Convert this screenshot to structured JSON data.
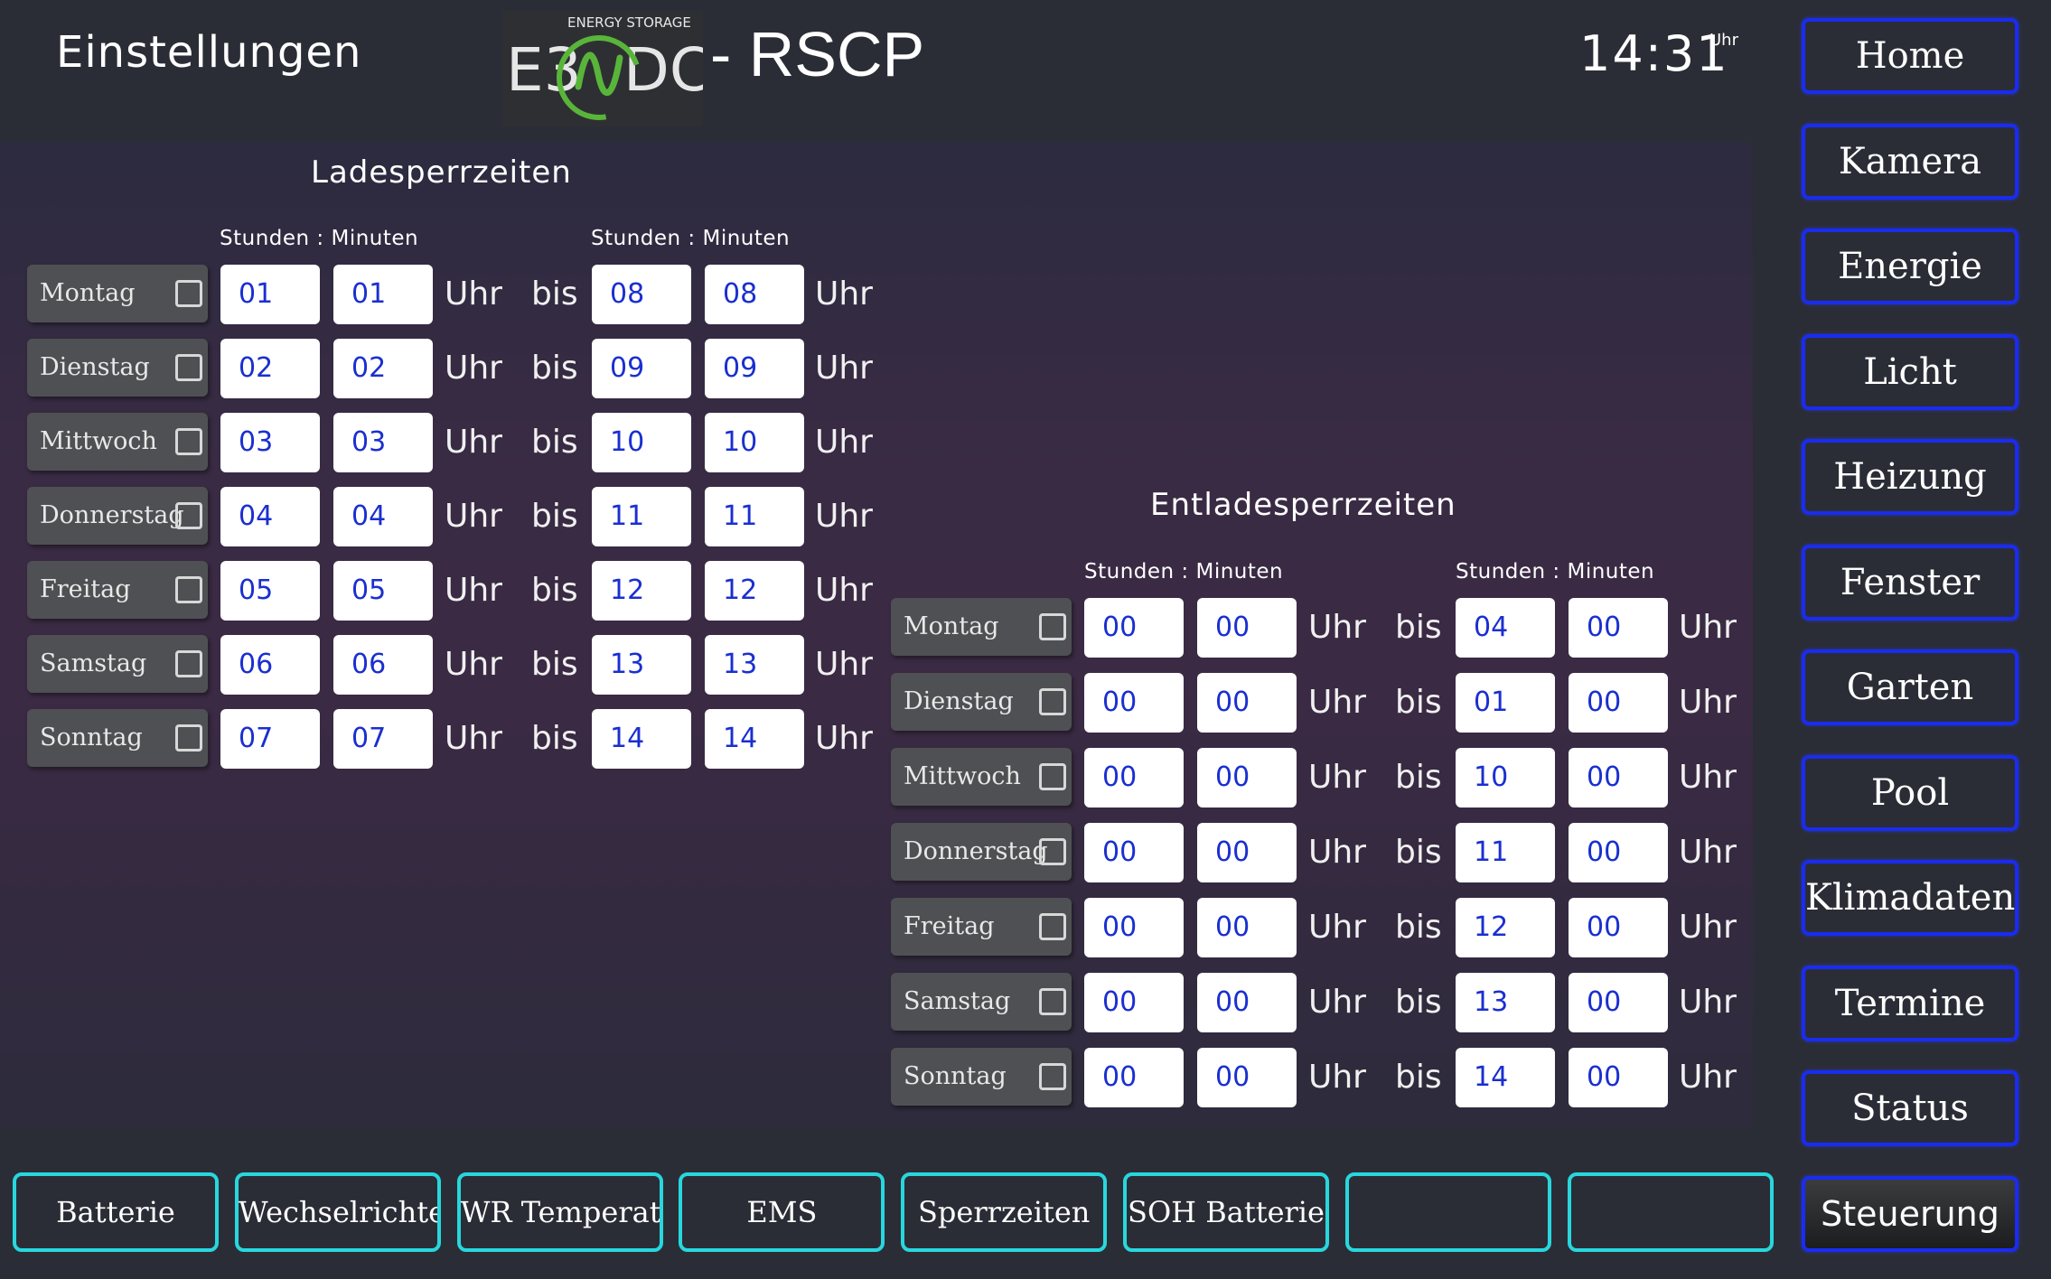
{
  "header": {
    "page_title": "Einstellungen",
    "logo_top_text": "ENERGY STORAGE",
    "logo_text_left": "E3",
    "logo_text_right": "DC",
    "app_title": "- RSCP",
    "clock": "14:31",
    "clock_unit": "Uhr"
  },
  "colors": {
    "nav_border": "#1a2cf0",
    "bottom_border": "#28d7de",
    "field_text": "#1a2fd0",
    "logo_green": "#58b53a"
  },
  "lade": {
    "title": "Ladesperrzeiten",
    "col_head_from": "Stunden : Minuten",
    "col_head_to": "Stunden : Minuten",
    "unit": "Uhr",
    "sep": "bis",
    "rows": [
      {
        "day": "Montag",
        "checked": false,
        "from_h": "01",
        "from_m": "01",
        "to_h": "08",
        "to_m": "08"
      },
      {
        "day": "Dienstag",
        "checked": false,
        "from_h": "02",
        "from_m": "02",
        "to_h": "09",
        "to_m": "09"
      },
      {
        "day": "Mittwoch",
        "checked": false,
        "from_h": "03",
        "from_m": "03",
        "to_h": "10",
        "to_m": "10"
      },
      {
        "day": "Donnerstag",
        "checked": false,
        "from_h": "04",
        "from_m": "04",
        "to_h": "11",
        "to_m": "11"
      },
      {
        "day": "Freitag",
        "checked": false,
        "from_h": "05",
        "from_m": "05",
        "to_h": "12",
        "to_m": "12"
      },
      {
        "day": "Samstag",
        "checked": false,
        "from_h": "06",
        "from_m": "06",
        "to_h": "13",
        "to_m": "13"
      },
      {
        "day": "Sonntag",
        "checked": false,
        "from_h": "07",
        "from_m": "07",
        "to_h": "14",
        "to_m": "14"
      }
    ]
  },
  "entlade": {
    "title": "Entladesperrzeiten",
    "col_head_from": "Stunden : Minuten",
    "col_head_to": "Stunden : Minuten",
    "unit": "Uhr",
    "sep": "bis",
    "rows": [
      {
        "day": "Montag",
        "checked": false,
        "from_h": "00",
        "from_m": "00",
        "to_h": "04",
        "to_m": "00"
      },
      {
        "day": "Dienstag",
        "checked": false,
        "from_h": "00",
        "from_m": "00",
        "to_h": "01",
        "to_m": "00"
      },
      {
        "day": "Mittwoch",
        "checked": false,
        "from_h": "00",
        "from_m": "00",
        "to_h": "10",
        "to_m": "00"
      },
      {
        "day": "Donnerstag",
        "checked": false,
        "from_h": "00",
        "from_m": "00",
        "to_h": "11",
        "to_m": "00"
      },
      {
        "day": "Freitag",
        "checked": false,
        "from_h": "00",
        "from_m": "00",
        "to_h": "12",
        "to_m": "00"
      },
      {
        "day": "Samstag",
        "checked": false,
        "from_h": "00",
        "from_m": "00",
        "to_h": "13",
        "to_m": "00"
      },
      {
        "day": "Sonntag",
        "checked": false,
        "from_h": "00",
        "from_m": "00",
        "to_h": "14",
        "to_m": "00"
      }
    ]
  },
  "nav": [
    {
      "label": "Home"
    },
    {
      "label": "Kamera"
    },
    {
      "label": "Energie"
    },
    {
      "label": "Licht"
    },
    {
      "label": "Heizung"
    },
    {
      "label": "Fenster"
    },
    {
      "label": "Garten"
    },
    {
      "label": "Pool"
    },
    {
      "label": "Klimadaten"
    },
    {
      "label": "Termine"
    },
    {
      "label": "Status"
    },
    {
      "label": "Steuerung",
      "active": true
    }
  ],
  "bottom_tabs": [
    {
      "label": "Batterie"
    },
    {
      "label": "Wechselrichter"
    },
    {
      "label": "WR Temperatur"
    },
    {
      "label": "EMS"
    },
    {
      "label": "Sperrzeiten"
    },
    {
      "label": "SOH Batterie"
    },
    {
      "label": ""
    },
    {
      "label": ""
    }
  ]
}
